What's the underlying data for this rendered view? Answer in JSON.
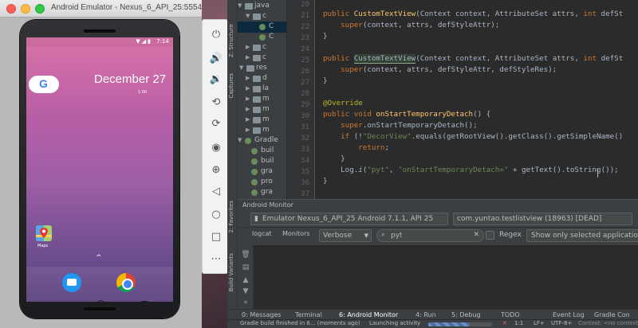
{
  "emulator": {
    "window_title": "Android Emulator - Nexus_6_API_25:5554",
    "status_time": "7:14",
    "date_big": "December 27",
    "date_small": "1:00",
    "maps_label": "Maps",
    "up_chevron": "^"
  },
  "editor": {
    "line_numbers": [
      "20",
      "21",
      "22",
      "23",
      "24",
      "25",
      "26",
      "27",
      "28",
      "29",
      "30",
      "31",
      "32",
      "33",
      "34",
      "35",
      "36",
      "37",
      "38"
    ]
  },
  "project_tree": [
    {
      "text": "java",
      "arrow": "▼"
    },
    {
      "text": "c",
      "arrow": "▼"
    },
    {
      "text": "C",
      "arrow": ""
    },
    {
      "text": "C",
      "arrow": ""
    },
    {
      "text": "c",
      "arrow": "▶"
    },
    {
      "text": "c",
      "arrow": "▶"
    },
    {
      "text": "res",
      "arrow": "▼"
    },
    {
      "text": "d",
      "arrow": "▶"
    },
    {
      "text": "la",
      "arrow": "▶"
    },
    {
      "text": "m",
      "arrow": "▶"
    },
    {
      "text": "m",
      "arrow": "▶"
    },
    {
      "text": "m",
      "arrow": "▶"
    },
    {
      "text": "m",
      "arrow": "▶"
    },
    {
      "text": "Gradle",
      "arrow": "▼"
    },
    {
      "text": "buil",
      "arrow": ""
    },
    {
      "text": "buil",
      "arrow": ""
    },
    {
      "text": "gra",
      "arrow": ""
    },
    {
      "text": "pro",
      "arrow": ""
    },
    {
      "text": "gra",
      "arrow": ""
    }
  ],
  "left_stripe": {
    "structure": "Z: Structure",
    "captures": "Captures",
    "favorites": "2: Favorites",
    "build_variants": "Build Variants"
  },
  "android_monitor": {
    "title": "Android Monitor",
    "device": "Emulator Nexus_6_API_25 Android 7.1.1, API 25",
    "process": "com.yuntao.testlistview (18963) [DEAD]",
    "logcat_tab": "logcat",
    "monitors_tab": "Monitors",
    "log_level": "Verbose",
    "search_value": "pyt",
    "regex_label": "Regex",
    "filter": "Show only selected application"
  },
  "bottom_tabs": [
    {
      "label": "0: Messages",
      "active": false
    },
    {
      "label": "Terminal",
      "active": false
    },
    {
      "label": "6: Android Monitor",
      "active": true
    },
    {
      "label": "4: Run",
      "active": false
    },
    {
      "label": "5: Debug",
      "active": false
    },
    {
      "label": "TODO",
      "active": false
    },
    {
      "label": "Event Log",
      "active": false
    },
    {
      "label": "Gradle Con",
      "active": false
    }
  ],
  "statusline": {
    "message": "Gradle build finished in 6... (moments ago)",
    "activity": "Launching activity",
    "position": "1:1",
    "line_sep": "LF+",
    "encoding": "UTF-8+",
    "context": "Context: <no context>"
  },
  "progress": 0.65,
  "colors": {
    "ide_bg": "#2b2b2b",
    "keyword": "#cc7832",
    "function": "#ffc66d",
    "string": "#6a8759",
    "annotation": "#bbb529"
  }
}
